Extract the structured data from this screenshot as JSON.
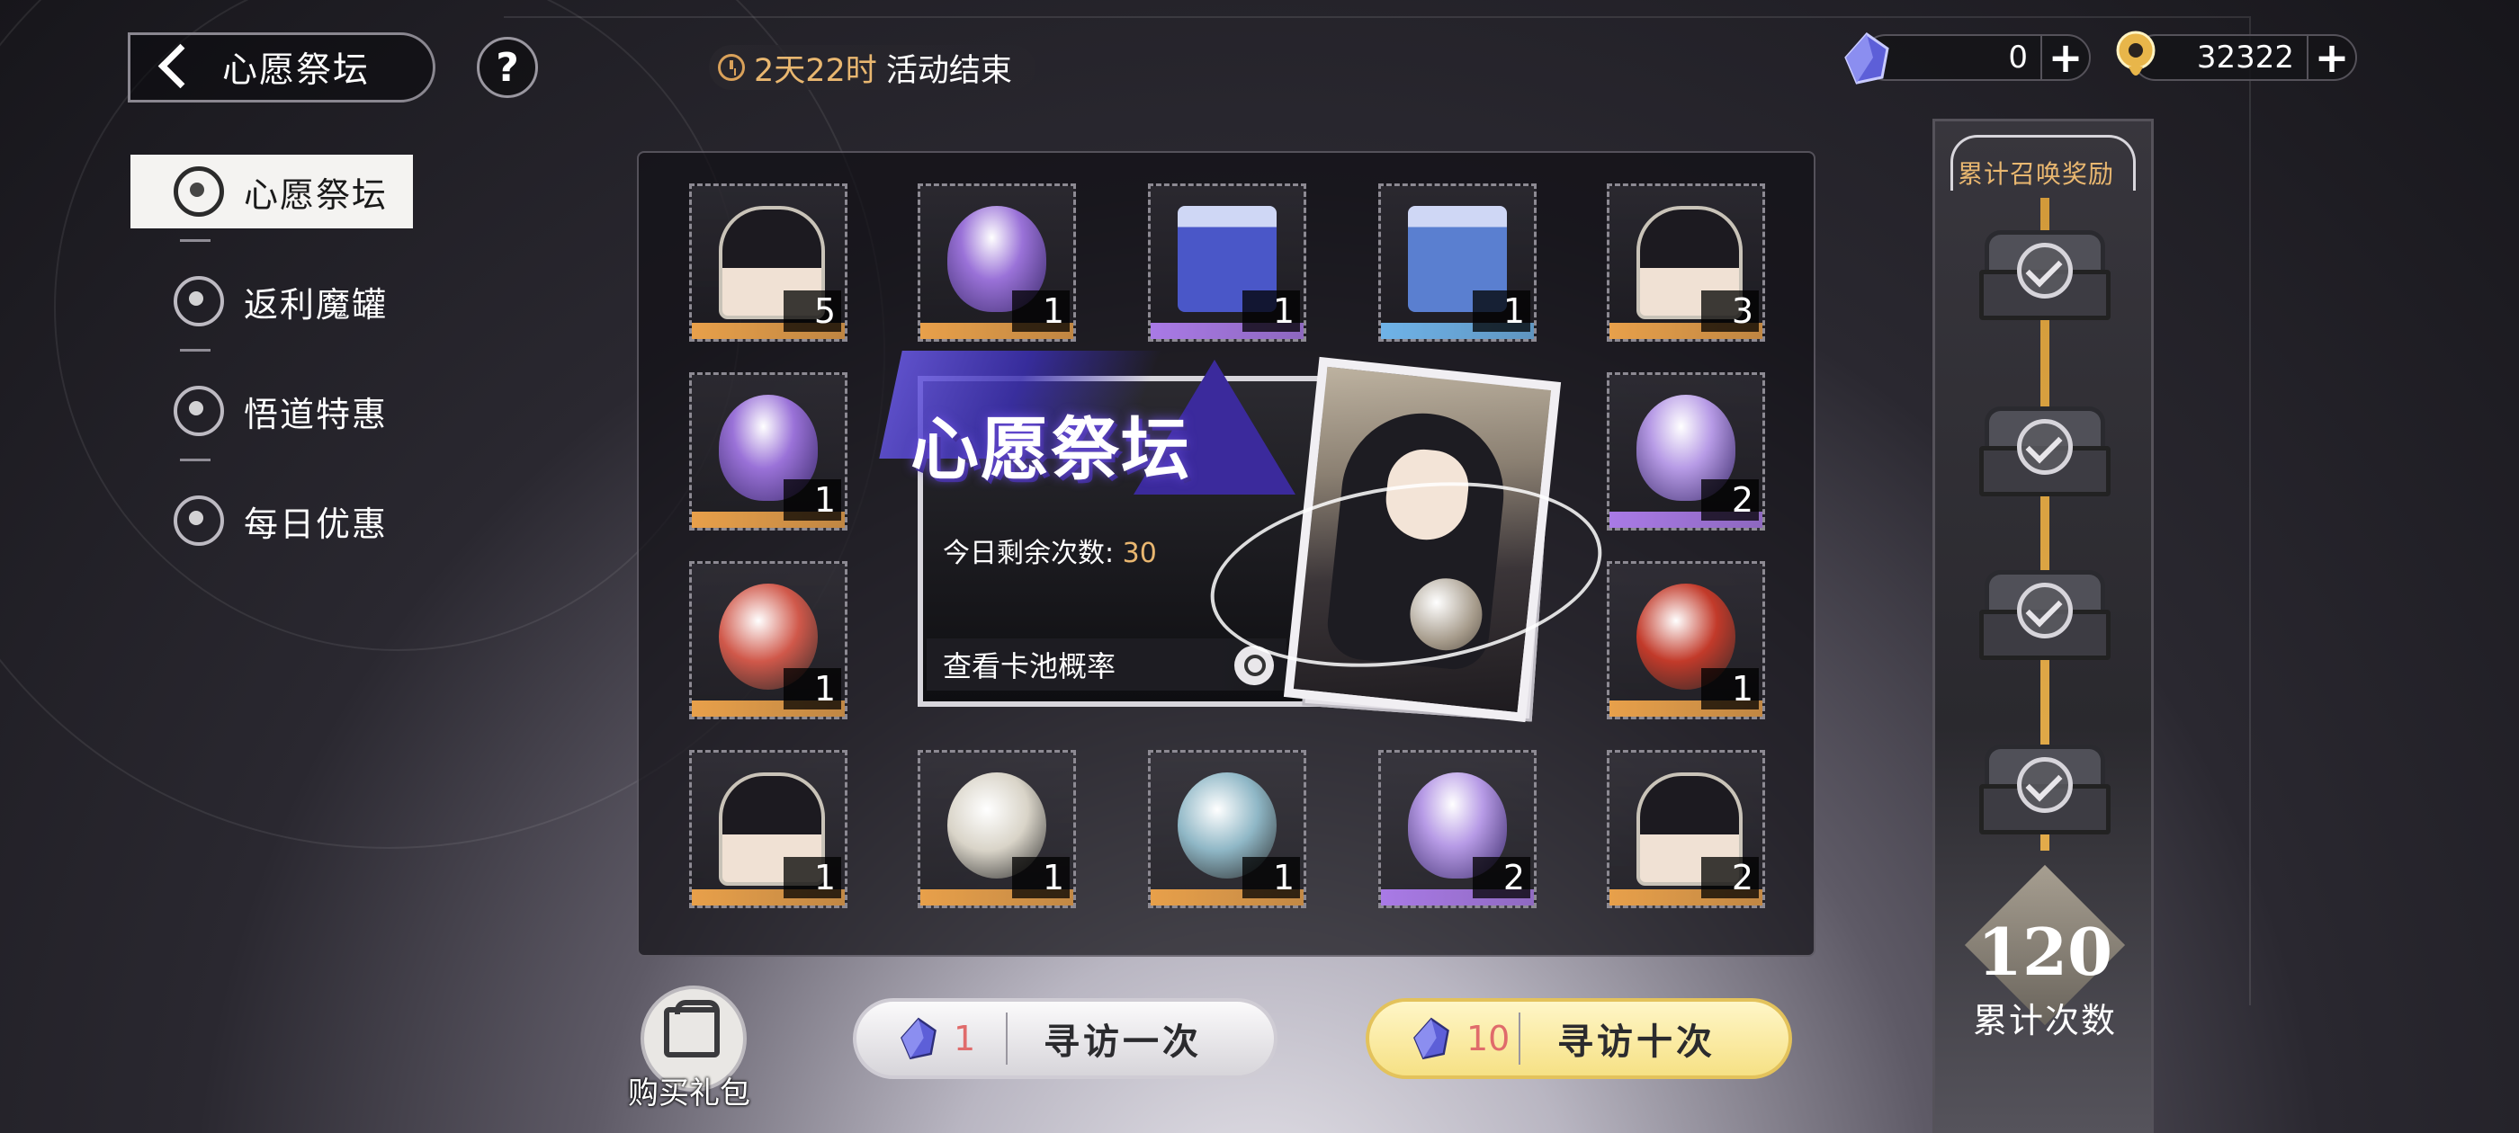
{
  "header": {
    "back_title": "心愿祭坛",
    "help_label": "?",
    "timer_days": "2天22时",
    "timer_suffix": "活动结束",
    "currencies": [
      {
        "icon": "crystal-icon",
        "value": "0",
        "plus": "+"
      },
      {
        "icon": "gold-coin-icon",
        "value": "32322",
        "plus": "+"
      }
    ]
  },
  "nav": {
    "items": [
      {
        "label": "心愿祭坛",
        "icon": "altar-icon",
        "active": true
      },
      {
        "label": "返利魔罐",
        "icon": "jar-icon",
        "active": false
      },
      {
        "label": "悟道特惠",
        "icon": "flame-icon",
        "active": false
      },
      {
        "label": "每日优惠",
        "icon": "swirl-icon",
        "active": false
      }
    ]
  },
  "grid": {
    "items": [
      {
        "name": "character-card",
        "qty": "5",
        "rarity": "orange"
      },
      {
        "name": "purple-egg",
        "qty": "1",
        "rarity": "orange"
      },
      {
        "name": "blue-book",
        "qty": "1",
        "rarity": "purple"
      },
      {
        "name": "gift-box",
        "qty": "1",
        "rarity": "blue"
      },
      {
        "name": "character-card",
        "qty": "3",
        "rarity": "orange"
      },
      {
        "name": "purple-egg",
        "qty": "1",
        "rarity": "orange"
      },
      {
        "name": "winged-egg",
        "qty": "2",
        "rarity": "purple"
      },
      {
        "name": "fire-stone",
        "qty": "1",
        "rarity": "orange"
      },
      {
        "name": "red-orb",
        "qty": "1",
        "rarity": "orange"
      },
      {
        "name": "character-card",
        "qty": "1",
        "rarity": "orange"
      },
      {
        "name": "cloud-relic",
        "qty": "1",
        "rarity": "orange"
      },
      {
        "name": "jade-key",
        "qty": "1",
        "rarity": "orange"
      },
      {
        "name": "winged-egg",
        "qty": "2",
        "rarity": "purple"
      },
      {
        "name": "character-card",
        "qty": "2",
        "rarity": "orange"
      }
    ]
  },
  "promo": {
    "title": "心愿祭坛",
    "remain_label": "今日剩余次数:",
    "remain_value": "30",
    "rate_label": "查看卡池概率"
  },
  "bottom": {
    "gift_label": "购买礼包",
    "draw_one": {
      "cost": "1",
      "label": "寻访一次"
    },
    "draw_ten": {
      "cost": "10",
      "label": "寻访十次"
    }
  },
  "rewards": {
    "title": "累计召唤奖励",
    "count": "120",
    "count_label": "累计次数"
  },
  "colors": {
    "accent_gold": "#e9b770",
    "rarity_orange": "#e8a04a",
    "rarity_purple": "#a97ae6",
    "rarity_blue": "#6fb3e8",
    "cost_red": "#e06b6b"
  }
}
